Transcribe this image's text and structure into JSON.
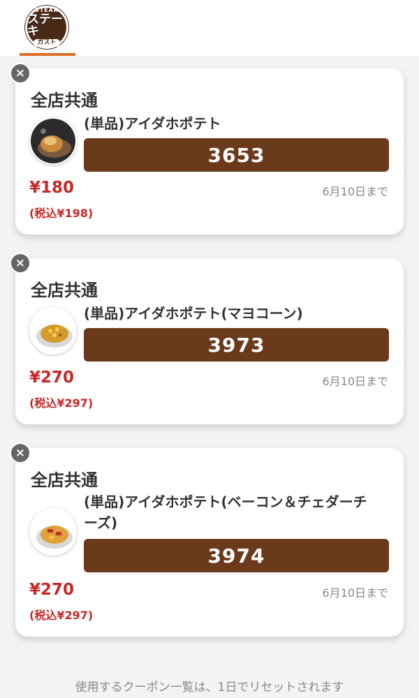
{
  "header": {
    "logo": {
      "top": "STEAK",
      "main": "ステーキ",
      "sub": "ガスト"
    }
  },
  "coupons": [
    {
      "scope": "全店共通",
      "name": "(単品)アイダホポテト",
      "code": "3653",
      "price": "¥180",
      "price_tax_in": "(税込¥198)",
      "expiry": "6月10日まで",
      "close_icon": "×"
    },
    {
      "scope": "全店共通",
      "name": "(単品)アイダホポテト(マヨコーン)",
      "code": "3973",
      "price": "¥270",
      "price_tax_in": "(税込¥297)",
      "expiry": "6月10日まで",
      "close_icon": "×"
    },
    {
      "scope": "全店共通",
      "name": "(単品)アイダホポテト(ベーコン＆チェダーチーズ)",
      "code": "3974",
      "price": "¥270",
      "price_tax_in": "(税込¥297)",
      "expiry": "6月10日まで",
      "close_icon": "×"
    }
  ],
  "footer_note": "使用するクーポン一覧は、1日でリセットされます",
  "colors": {
    "accent": "#e06d25",
    "code_bg": "#6b3a1b",
    "price": "#c62828",
    "logo_bg": "#4a2a16"
  }
}
